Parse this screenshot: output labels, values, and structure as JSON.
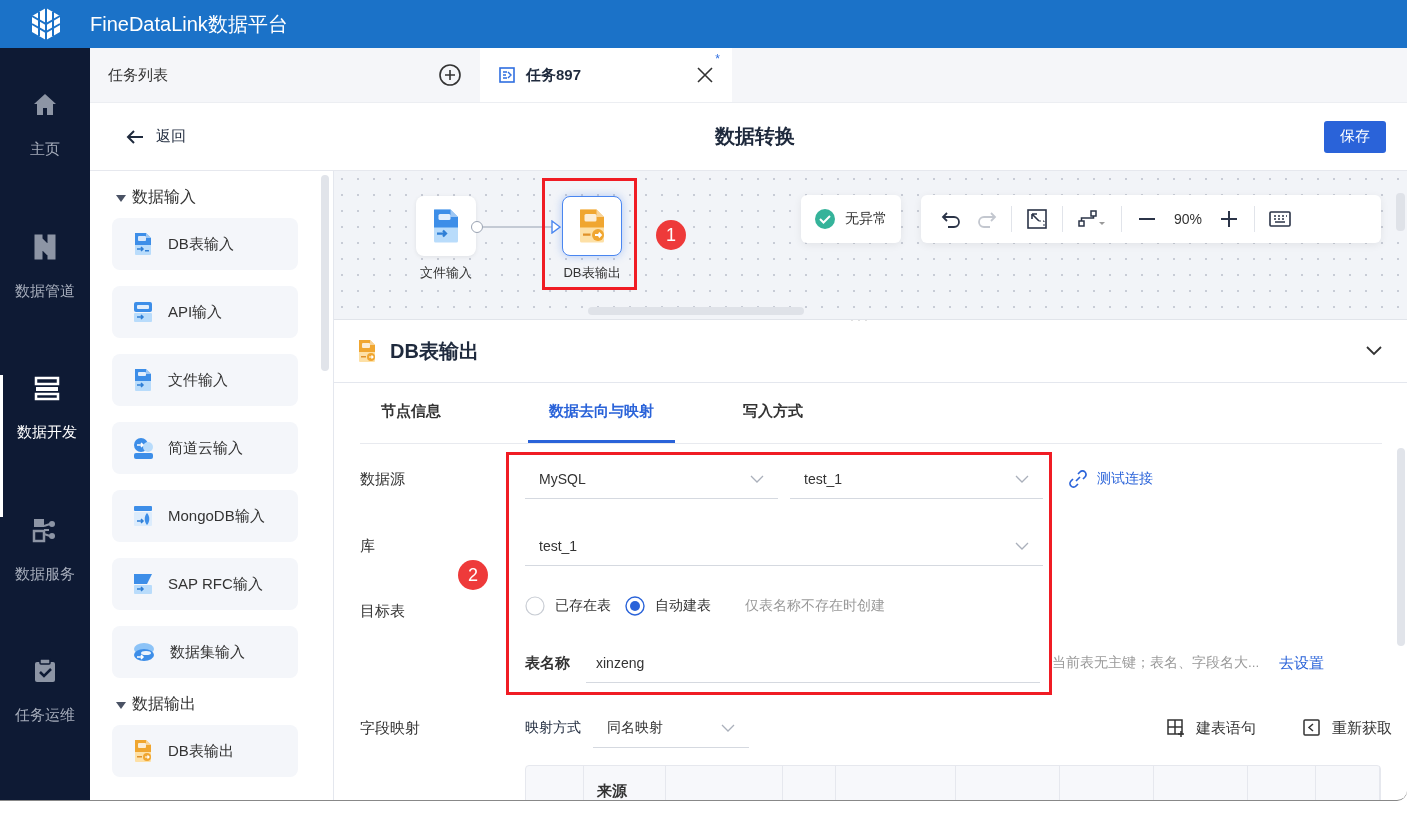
{
  "app": {
    "title": "FineDataLink数据平台"
  },
  "nav": [
    {
      "label": "主页",
      "kind": "home",
      "selected": false
    },
    {
      "label": "数据管道",
      "kind": "pipeline",
      "selected": false
    },
    {
      "label": "数据开发",
      "kind": "dev",
      "selected": true
    },
    {
      "label": "数据服务",
      "kind": "service",
      "selected": false
    },
    {
      "label": "任务运维",
      "kind": "ops",
      "selected": false
    }
  ],
  "tabs": [
    {
      "label": "任务列表",
      "kind": "list",
      "selected": false
    },
    {
      "label": "任务897",
      "kind": "task",
      "selected": true,
      "modified_mark": "*"
    }
  ],
  "page": {
    "back": "返回",
    "title": "数据转换",
    "save": "保存"
  },
  "palette": {
    "groups": [
      {
        "label": "数据输入",
        "expanded": true,
        "items": [
          {
            "label": "DB表输入",
            "kind": "db-in"
          },
          {
            "label": "API输入",
            "kind": "api"
          },
          {
            "label": "文件输入",
            "kind": "file"
          },
          {
            "label": "简道云输入",
            "kind": "cloud"
          },
          {
            "label": "MongoDB输入",
            "kind": "mongo"
          },
          {
            "label": "SAP RFC输入",
            "kind": "sap"
          },
          {
            "label": "数据集输入",
            "kind": "dataset"
          }
        ]
      },
      {
        "label": "数据输出",
        "expanded": true,
        "items": [
          {
            "label": "DB表输出",
            "kind": "db-out"
          }
        ]
      }
    ]
  },
  "canvas": {
    "nodes": [
      {
        "label": "文件输入",
        "kind": "file",
        "selected": false
      },
      {
        "label": "DB表输出",
        "kind": "db-out",
        "selected": true
      }
    ],
    "annotation": "1",
    "status": "无异常",
    "tools": [
      {
        "kind": "undo",
        "disabled": false
      },
      {
        "kind": "redo",
        "disabled": true
      },
      {
        "kind": "fit",
        "disabled": false
      },
      {
        "kind": "layout",
        "disabled": false
      },
      {
        "kind": "zoom-out",
        "disabled": false
      },
      {
        "kind": "zoom",
        "text": "90%"
      },
      {
        "kind": "zoom-in",
        "disabled": false
      },
      {
        "kind": "keyboard",
        "disabled": false
      }
    ]
  },
  "detail": {
    "title": "DB表输出",
    "kind": "db-out",
    "expanded": true,
    "tabs": [
      {
        "label": "节点信息",
        "selected": false
      },
      {
        "label": "数据去向与映射",
        "selected": true
      },
      {
        "label": "写入方式",
        "selected": false
      }
    ],
    "annotation": "2",
    "datasource": {
      "label": "数据源",
      "type": "MySQL",
      "connection": "test_1",
      "test_link": "测试连接"
    },
    "database": {
      "label": "库",
      "value": "test_1"
    },
    "target": {
      "label": "目标表",
      "options": [
        {
          "label": "已存在表",
          "selected": false
        },
        {
          "label": "自动建表",
          "selected": true
        }
      ],
      "hint": "仅表名称不存在时创建",
      "name_label": "表名称",
      "name_value": "xinzeng",
      "warning": "当前表无主键；表名、字段名大...",
      "settings_link": "去设置"
    },
    "mapping": {
      "label": "字段映射",
      "mode_label": "映射方式",
      "mode": "同名映射",
      "buttons": [
        {
          "label": "建表语句",
          "kind": "grid"
        },
        {
          "label": "重新获取",
          "kind": "refresh"
        }
      ],
      "columns": [
        "来源"
      ]
    }
  }
}
